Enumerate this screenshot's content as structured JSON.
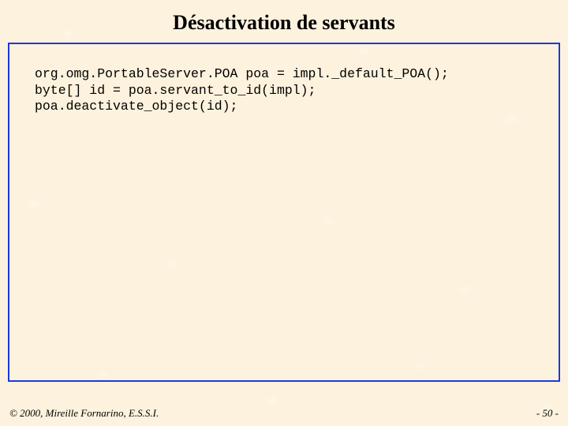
{
  "title": "Désactivation de servants",
  "code": {
    "line1": "org.omg.PortableServer.POA poa = impl._default_POA();",
    "line2": "byte[] id = poa.servant_to_id(impl);",
    "line3": "poa.deactivate_object(id);"
  },
  "footer": {
    "copyright": "© 2000, Mireille Fornarino, E.S.S.I.",
    "page": "- 50 -"
  }
}
